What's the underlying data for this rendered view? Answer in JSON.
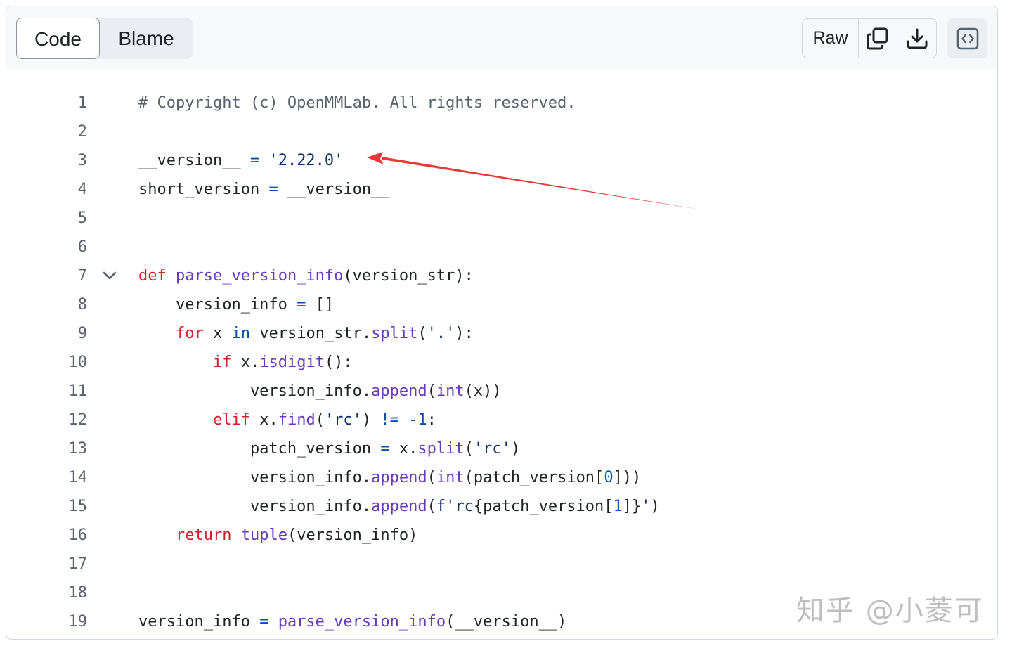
{
  "toolbar": {
    "tabs": [
      {
        "label": "Code",
        "active": true
      },
      {
        "label": "Blame",
        "active": false
      }
    ],
    "raw_label": "Raw",
    "icons": {
      "copy": "copy-icon",
      "download": "download-icon",
      "symbols": "code-symbols-icon"
    }
  },
  "code": {
    "lines": [
      {
        "number": "1",
        "tokens": [
          {
            "t": "# Copyright (c) OpenMMLab. All rights reserved.",
            "c": "c"
          }
        ]
      },
      {
        "number": "2",
        "tokens": []
      },
      {
        "number": "3",
        "tokens": [
          {
            "t": "__version__ "
          },
          {
            "t": "=",
            "c": "o"
          },
          {
            "t": " "
          },
          {
            "t": "'2.22.0'",
            "c": "s"
          }
        ]
      },
      {
        "number": "4",
        "tokens": [
          {
            "t": "short_version "
          },
          {
            "t": "=",
            "c": "o"
          },
          {
            "t": " __version__"
          }
        ]
      },
      {
        "number": "5",
        "tokens": []
      },
      {
        "number": "6",
        "tokens": []
      },
      {
        "number": "7",
        "fold": true,
        "tokens": [
          {
            "t": "def",
            "c": "k"
          },
          {
            "t": " "
          },
          {
            "t": "parse_version_info",
            "c": "f"
          },
          {
            "t": "(version_str):"
          }
        ]
      },
      {
        "number": "8",
        "tokens": [
          {
            "t": "    version_info "
          },
          {
            "t": "=",
            "c": "o"
          },
          {
            "t": " []"
          }
        ]
      },
      {
        "number": "9",
        "tokens": [
          {
            "t": "    "
          },
          {
            "t": "for",
            "c": "k"
          },
          {
            "t": " x "
          },
          {
            "t": "in",
            "c": "o"
          },
          {
            "t": " version_str."
          },
          {
            "t": "split",
            "c": "f"
          },
          {
            "t": "("
          },
          {
            "t": "'.'",
            "c": "s"
          },
          {
            "t": "):"
          }
        ]
      },
      {
        "number": "10",
        "tokens": [
          {
            "t": "        "
          },
          {
            "t": "if",
            "c": "k"
          },
          {
            "t": " x."
          },
          {
            "t": "isdigit",
            "c": "f"
          },
          {
            "t": "():"
          }
        ]
      },
      {
        "number": "11",
        "tokens": [
          {
            "t": "            version_info."
          },
          {
            "t": "append",
            "c": "f"
          },
          {
            "t": "("
          },
          {
            "t": "int",
            "c": "f"
          },
          {
            "t": "(x))"
          }
        ]
      },
      {
        "number": "12",
        "tokens": [
          {
            "t": "        "
          },
          {
            "t": "elif",
            "c": "k"
          },
          {
            "t": " x."
          },
          {
            "t": "find",
            "c": "f"
          },
          {
            "t": "("
          },
          {
            "t": "'rc'",
            "c": "s"
          },
          {
            "t": ") "
          },
          {
            "t": "!=",
            "c": "o"
          },
          {
            "t": " "
          },
          {
            "t": "-1",
            "c": "n"
          },
          {
            "t": ":"
          }
        ]
      },
      {
        "number": "13",
        "tokens": [
          {
            "t": "            patch_version "
          },
          {
            "t": "=",
            "c": "o"
          },
          {
            "t": " x."
          },
          {
            "t": "split",
            "c": "f"
          },
          {
            "t": "("
          },
          {
            "t": "'rc'",
            "c": "s"
          },
          {
            "t": ")"
          }
        ]
      },
      {
        "number": "14",
        "tokens": [
          {
            "t": "            version_info."
          },
          {
            "t": "append",
            "c": "f"
          },
          {
            "t": "("
          },
          {
            "t": "int",
            "c": "f"
          },
          {
            "t": "(patch_version["
          },
          {
            "t": "0",
            "c": "n"
          },
          {
            "t": "]))"
          }
        ]
      },
      {
        "number": "15",
        "tokens": [
          {
            "t": "            version_info."
          },
          {
            "t": "append",
            "c": "f"
          },
          {
            "t": "("
          },
          {
            "t": "f'rc",
            "c": "s"
          },
          {
            "t": "{patch_version["
          },
          {
            "t": "1",
            "c": "n"
          },
          {
            "t": "]}"
          },
          {
            "t": "'",
            "c": "s"
          },
          {
            "t": ")"
          }
        ]
      },
      {
        "number": "16",
        "tokens": [
          {
            "t": "    "
          },
          {
            "t": "return",
            "c": "k"
          },
          {
            "t": " "
          },
          {
            "t": "tuple",
            "c": "f"
          },
          {
            "t": "(version_info)"
          }
        ]
      },
      {
        "number": "17",
        "tokens": []
      },
      {
        "number": "18",
        "tokens": []
      },
      {
        "number": "19",
        "tokens": [
          {
            "t": "version_info "
          },
          {
            "t": "=",
            "c": "o"
          },
          {
            "t": " "
          },
          {
            "t": "parse_version_info",
            "c": "f"
          },
          {
            "t": "(__version__)"
          }
        ]
      }
    ]
  },
  "annotation": {
    "arrow_color": "#e53935"
  },
  "watermark": {
    "text": "知乎 @小菱可"
  }
}
